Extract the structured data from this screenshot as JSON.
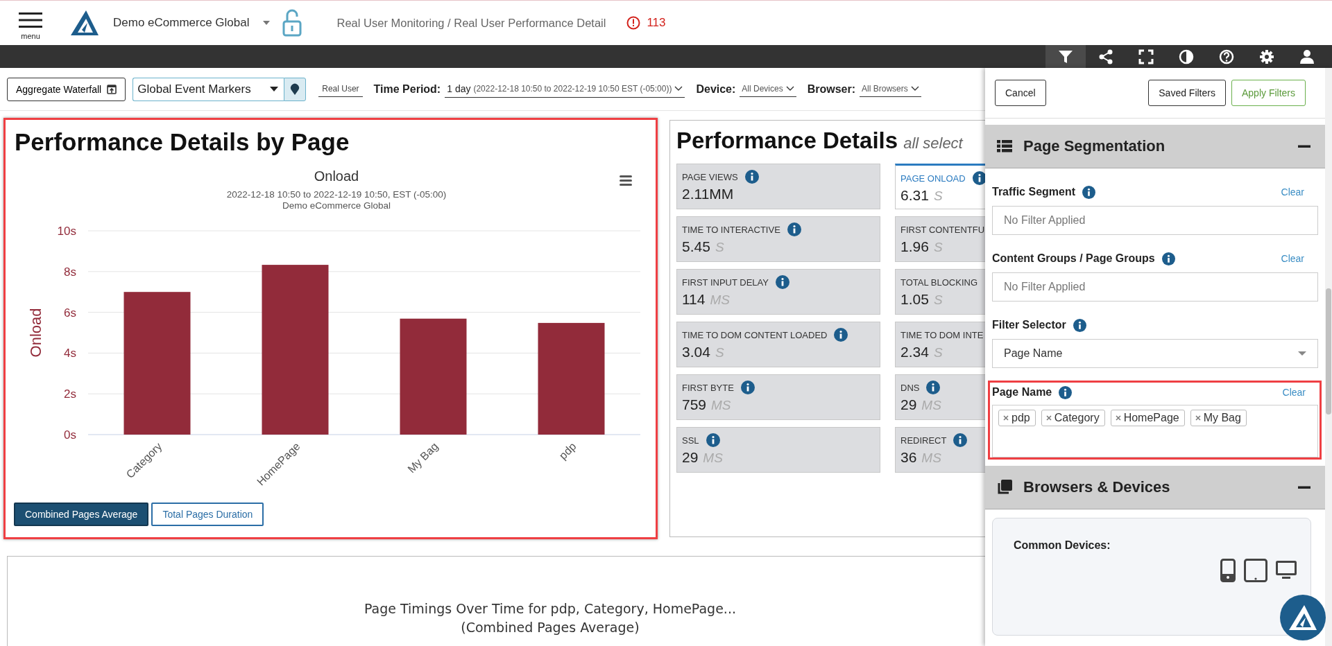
{
  "header": {
    "menu_label": "menu",
    "app_name": "Demo eCommerce Global",
    "breadcrumb": "Real User Monitoring / Real User Performance Detail",
    "alert_count": "113"
  },
  "toolbar_icons": [
    {
      "kind": "filter",
      "selected": true
    },
    {
      "kind": "share",
      "selected": false
    },
    {
      "kind": "fullscreen",
      "selected": false
    },
    {
      "kind": "contrast",
      "selected": false
    },
    {
      "kind": "help",
      "selected": false
    },
    {
      "kind": "settings",
      "selected": false
    },
    {
      "kind": "user",
      "selected": false
    }
  ],
  "controls": {
    "aggregate_waterfall": "Aggregate Waterfall",
    "event_markers": "Global Event Markers",
    "data_source": "Real User",
    "time_period": {
      "label": "Time Period:",
      "value": "1 day",
      "range": "(2022-12-18 10:50 to 2022-12-19 10:50 EST (-05:00))"
    },
    "device": {
      "label": "Device:",
      "value": "All Devices"
    },
    "browser": {
      "label": "Browser:",
      "value": "All Browsers"
    }
  },
  "page_panel": {
    "title": "Performance Details by Page",
    "highlighted": true,
    "subtitle_lines": [
      "2022-12-18 10:50 to 2022-12-19 10:50, EST (-05:00)",
      "Demo eCommerce Global"
    ],
    "chart_data": {
      "type": "bar",
      "title": "Onload",
      "ylabel": "Onload",
      "categories": [
        "Category",
        "HomePage",
        "My Bag",
        "pdp"
      ],
      "grid": true,
      "series": [
        {
          "color": "#922b3a",
          "values": [
            7.0,
            8.33,
            5.69,
            5.48
          ]
        }
      ],
      "ylim": [
        0,
        10
      ],
      "yticks": [
        {
          "value": 0,
          "label": "0s"
        },
        {
          "value": 2,
          "label": "2s"
        },
        {
          "value": 4,
          "label": "4s"
        },
        {
          "value": 6,
          "label": "6s"
        },
        {
          "value": 8,
          "label": "8s"
        },
        {
          "value": 10,
          "label": "10s"
        }
      ]
    },
    "buttons": [
      {
        "label": "Combined Pages Average",
        "selected": true
      },
      {
        "label": "Total Pages Duration",
        "selected": false
      }
    ]
  },
  "details_panel": {
    "title": "Performance Details",
    "subtitle": "all select",
    "metrics": [
      {
        "label": "PAGE VIEWS",
        "value": "2.11MM",
        "info": true,
        "selected": false
      },
      {
        "label": "PAGE ONLOAD",
        "value": "6.31",
        "unit": "S",
        "info": true,
        "selected": true
      },
      {
        "label": "TIME TO INTERACTIVE",
        "value": "5.45",
        "unit": "S",
        "info": true,
        "selected": false
      },
      {
        "label": "FIRST CONTENTFU",
        "value": "1.96",
        "unit": "S",
        "info": false,
        "selected": false
      },
      {
        "label": "FIRST INPUT DELAY",
        "value": "114",
        "unit": "MS",
        "info": true,
        "selected": false
      },
      {
        "label": "TOTAL BLOCKING",
        "value": "1.05",
        "unit": "S",
        "info": false,
        "selected": false
      },
      {
        "label": "TIME TO DOM CONTENT LOADED",
        "value": "3.04",
        "unit": "S",
        "info": true,
        "selected": false
      },
      {
        "label": "TIME TO DOM INTE",
        "value": "2.34",
        "unit": "S",
        "info": false,
        "selected": false
      },
      {
        "label": "FIRST BYTE",
        "value": "759",
        "unit": "MS",
        "info": true,
        "selected": false
      },
      {
        "label": "DNS",
        "value": "29",
        "unit": "MS",
        "info": true,
        "selected": false
      },
      {
        "label": "SSL",
        "value": "29",
        "unit": "MS",
        "info": true,
        "selected": false
      },
      {
        "label": "REDIRECT",
        "value": "36",
        "unit": "MS",
        "info": true,
        "selected": false
      }
    ]
  },
  "timings_panel": {
    "title_lines": [
      "Page Timings Over Time for pdp, Category, HomePage...",
      "(Combined Pages Average)"
    ]
  },
  "filter_panel": {
    "buttons": [
      {
        "label": "Cancel",
        "kind": "cancel"
      },
      {
        "label": "Saved Filters",
        "kind": "saved"
      },
      {
        "label": "Apply Filters",
        "kind": "apply"
      }
    ],
    "page_segmentation": {
      "title": "Page Segmentation",
      "expanded": true,
      "filters": [
        {
          "label": "Traffic Segment",
          "clear": "Clear",
          "kind": "text",
          "placeholder": "No Filter Applied",
          "highlighted": false
        },
        {
          "label": "Content Groups / Page Groups",
          "clear": "Clear",
          "kind": "text",
          "placeholder": "No Filter Applied",
          "highlighted": false
        },
        {
          "label": "Filter Selector",
          "kind": "select",
          "value": "Page Name",
          "highlighted": false
        },
        {
          "label": "Page Name",
          "clear": "Clear",
          "kind": "tags",
          "tags": [
            "pdp",
            "Category",
            "HomePage",
            "My Bag"
          ],
          "highlighted": true
        }
      ]
    },
    "browsers_devices": {
      "title": "Browsers & Devices",
      "expanded": true,
      "common_devices": "Common Devices:"
    }
  }
}
